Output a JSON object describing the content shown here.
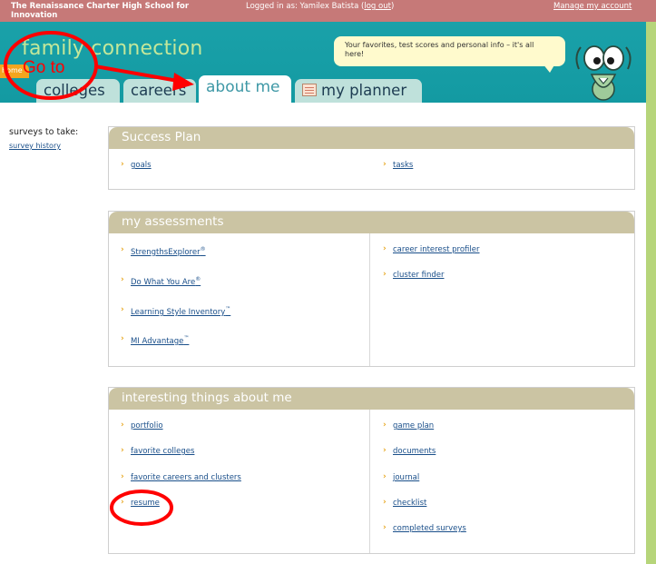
{
  "topbar": {
    "school": "The Renaissance Charter High School for Innovation",
    "logged_in_prefix": "Logged in as: Yamilex Batista",
    "logout_label": "log out",
    "manage_label": "Manage my account"
  },
  "header": {
    "brand": "family connection",
    "bubble": "Your favorites, test scores and personal info – it's all here!"
  },
  "tabs": {
    "home": "home",
    "colleges": "colleges",
    "careers": "careers",
    "about_me": "about me",
    "planner": "my planner"
  },
  "sidebar": {
    "surveys_label": "surveys to take:",
    "history_link": "survey history"
  },
  "panels": {
    "success": {
      "title": "Success Plan",
      "left": [
        "goals"
      ],
      "right": [
        "tasks"
      ]
    },
    "assessments": {
      "title": "my assessments",
      "left": [
        {
          "label": "StrengthsExplorer",
          "mark": "®"
        },
        {
          "label": "Do What You Are",
          "mark": "®"
        },
        {
          "label": "Learning Style Inventory",
          "mark": "™"
        },
        {
          "label": "MI Advantage",
          "mark": "™"
        }
      ],
      "right": [
        "career interest profiler",
        "cluster finder"
      ]
    },
    "interesting": {
      "title": "interesting things about me",
      "left": [
        "portfolio",
        "favorite colleges",
        "favorite careers and clusters",
        "resume"
      ],
      "right": [
        "game plan",
        "documents",
        "journal",
        "checklist",
        "completed surveys"
      ]
    }
  },
  "annotation": {
    "text": "Go to",
    "color": "#ff0000"
  }
}
